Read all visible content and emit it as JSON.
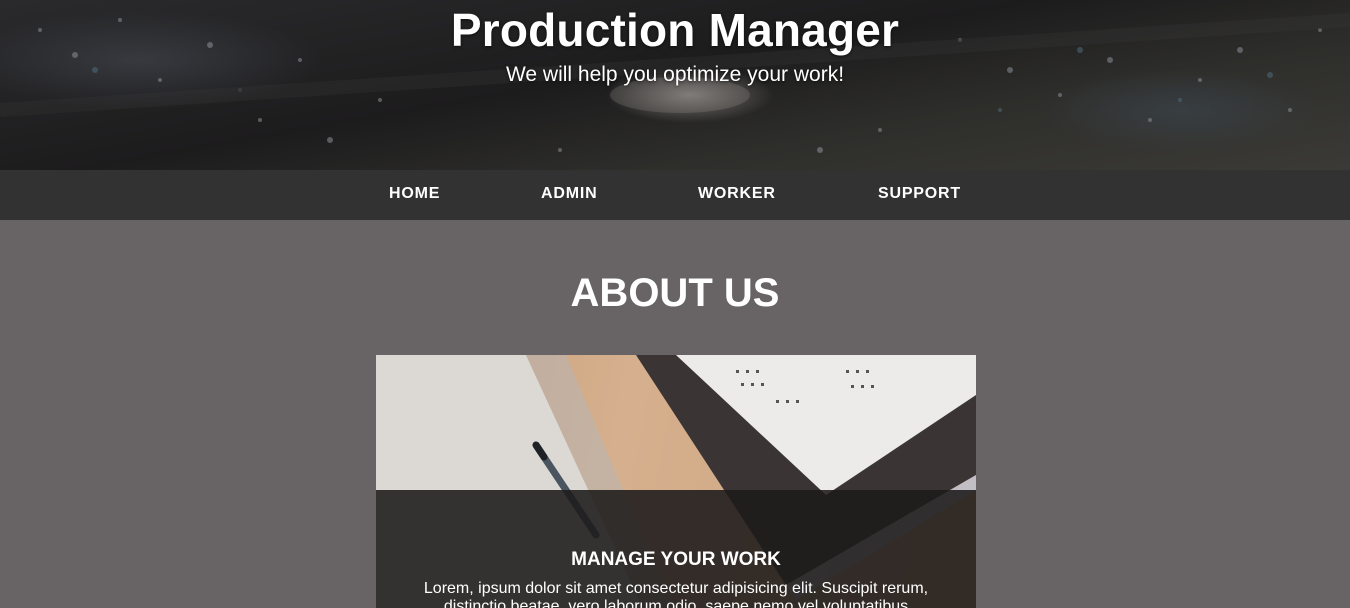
{
  "header": {
    "title": "Production Manager",
    "subtitle": "We will help you optimize your work!"
  },
  "nav": {
    "items": [
      {
        "label": "HOME"
      },
      {
        "label": "ADMIN"
      },
      {
        "label": "WORKER"
      },
      {
        "label": "SUPPORT"
      }
    ]
  },
  "about": {
    "title": "ABOUT US",
    "card": {
      "title": "MANAGE YOUR WORK",
      "text": "Lorem, ipsum dolor sit amet consectetur adipisicing elit. Suscipit rerum, distinctio beatae, vero laborum odio, saepe nemo vel voluptatibus"
    }
  },
  "colors": {
    "page_background": "#686364",
    "navbar": "#323232",
    "text": "#ffffff"
  }
}
